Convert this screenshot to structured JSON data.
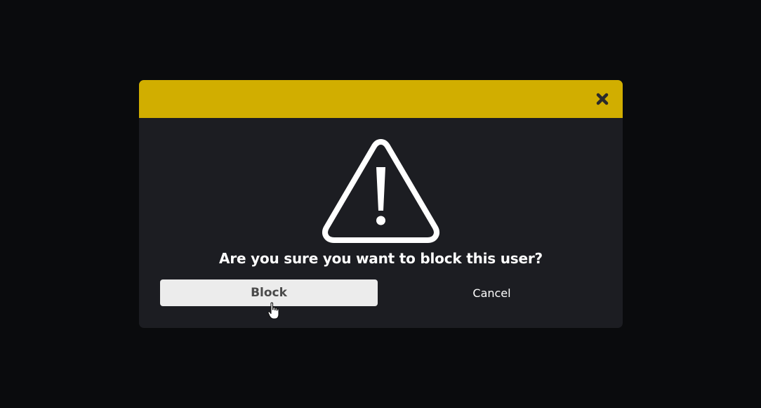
{
  "dialog": {
    "message": "Are you sure you want to block this user?",
    "confirm_label": "Block",
    "cancel_label": "Cancel",
    "close_icon": "close-icon",
    "warning_icon": "warning-icon"
  },
  "colors": {
    "backdrop": "#0a0b0d",
    "modal_background": "#1c1d22",
    "header_accent": "#d1ae00",
    "confirm_button_bg": "#ececec",
    "confirm_button_text": "#4a4a4a",
    "text": "#ffffff"
  }
}
